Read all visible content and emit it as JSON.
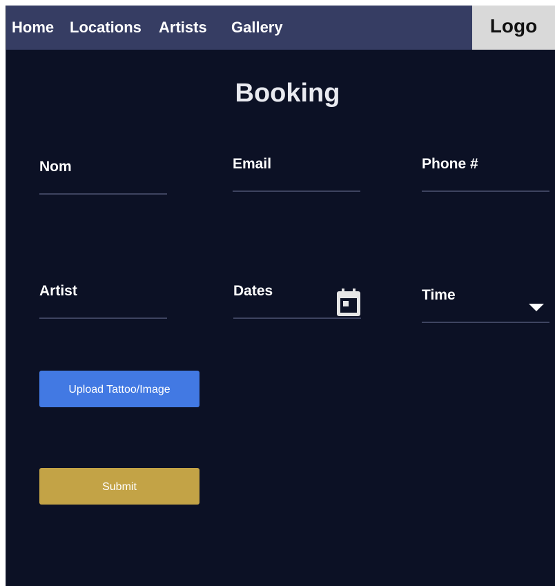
{
  "nav": {
    "items": [
      "Home",
      "Locations",
      "Artists",
      "Gallery"
    ],
    "logo": "Logo"
  },
  "page": {
    "title": "Booking"
  },
  "form": {
    "name_label": "Nom",
    "email_label": "Email",
    "phone_label": "Phone #",
    "artist_label": "Artist",
    "dates_label": "Dates",
    "time_label": "Time",
    "upload_label": "Upload Tattoo/Image",
    "submit_label": "Submit"
  },
  "icons": {
    "dates": "calendar-icon",
    "time": "chevron-down-icon"
  },
  "colors": {
    "nav_bg": "#363d63",
    "page_bg": "#0c1125",
    "upload_button": "#4279e3",
    "submit_button": "#c3a346"
  }
}
